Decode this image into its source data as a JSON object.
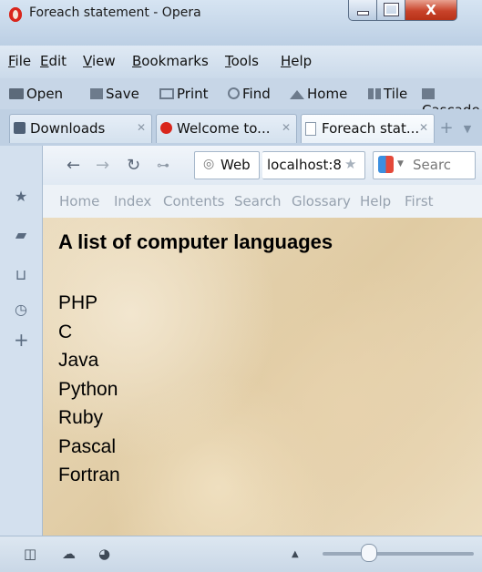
{
  "window": {
    "title": "Foreach statement - Opera",
    "close_glyph": "X"
  },
  "menubar": {
    "items": [
      {
        "label": "File",
        "accel": "F",
        "rest": "ile"
      },
      {
        "label": "Edit",
        "accel": "E",
        "rest": "dit"
      },
      {
        "label": "View",
        "accel": "V",
        "rest": "iew"
      },
      {
        "label": "Bookmarks",
        "accel": "B",
        "rest": "ookmarks"
      },
      {
        "label": "Tools",
        "accel": "T",
        "rest": "ools"
      },
      {
        "label": "Help",
        "accel": "H",
        "rest": "elp"
      }
    ]
  },
  "toolbar": {
    "items": [
      "Open",
      "Save",
      "Print",
      "Find",
      "Home",
      "Tile",
      "Cascade"
    ]
  },
  "tabs": [
    {
      "label": "Downloads",
      "icon": "downloads-icon",
      "active": false
    },
    {
      "label": "Welcome to...",
      "icon": "opera-icon",
      "active": false
    },
    {
      "label": "Foreach stat...",
      "icon": "page-icon",
      "active": true
    }
  ],
  "navbar": {
    "web_label": "Web",
    "address": "localhost:8",
    "search_placeholder": "Searc"
  },
  "linkbar": {
    "items": [
      "Home",
      "Index",
      "Contents",
      "Search",
      "Glossary",
      "Help",
      "First"
    ]
  },
  "content": {
    "heading": "A list of computer languages",
    "languages": [
      "PHP",
      "C",
      "Java",
      "Python",
      "Ruby",
      "Pascal",
      "Fortran"
    ]
  },
  "colors": {
    "opera_red": "#d9261c",
    "close_red": "#c8432a"
  }
}
